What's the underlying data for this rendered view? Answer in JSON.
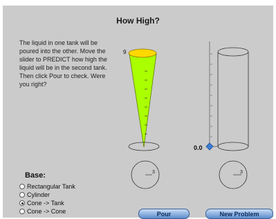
{
  "header": {
    "title": "How High?"
  },
  "instructions": {
    "text": "The liquid in one tank will be poured into the other. Move the slider to PREDICT how high the liquid will be in the second tank. Then click Pour to check. Were you right?"
  },
  "base": {
    "heading": "Base:",
    "options": [
      {
        "label": "Rectangular Tank",
        "selected": false
      },
      {
        "label": "Cylinder",
        "selected": false
      },
      {
        "label": "Cone -> Tank",
        "selected": true
      },
      {
        "label": "Cone -> Cone",
        "selected": false
      }
    ]
  },
  "source_tank": {
    "shape": "cone",
    "max_label": "9",
    "liquid_color": "#aaff00",
    "rim_color": "#ffd800",
    "gauge_value": "3"
  },
  "target_tank": {
    "shape": "cylinder",
    "gauge_value": "3"
  },
  "slider": {
    "value": "0.0",
    "handle_color": "#3c7fd6"
  },
  "buttons": {
    "pour_label": "Pour",
    "new_problem_label": "New Problem"
  }
}
